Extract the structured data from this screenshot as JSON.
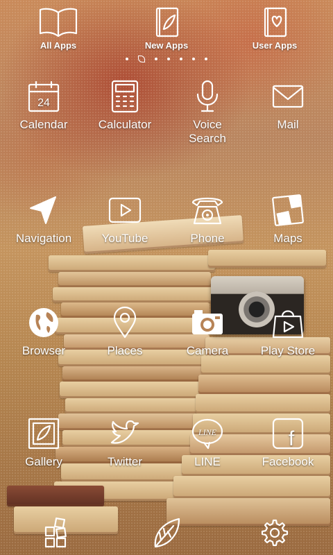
{
  "tabs": [
    {
      "label": "All Apps",
      "icon": "open-book-icon"
    },
    {
      "label": "New Apps",
      "icon": "leaf-book-icon"
    },
    {
      "label": "User Apps",
      "icon": "heart-book-icon"
    }
  ],
  "apps": [
    {
      "label": "Calendar",
      "icon": "calendar-icon",
      "day": "24"
    },
    {
      "label": "Calculator",
      "icon": "calculator-icon"
    },
    {
      "label": "Voice\nSearch",
      "icon": "microphone-icon"
    },
    {
      "label": "Mail",
      "icon": "envelope-icon"
    },
    {
      "label": "Navigation",
      "icon": "navigation-arrow-icon"
    },
    {
      "label": "YouTube",
      "icon": "play-button-icon"
    },
    {
      "label": "Phone",
      "icon": "rotary-phone-icon"
    },
    {
      "label": "Maps",
      "icon": "map-icon"
    },
    {
      "label": "Browser",
      "icon": "globe-icon"
    },
    {
      "label": "Places",
      "icon": "location-pin-icon"
    },
    {
      "label": "Camera",
      "icon": "camera-icon"
    },
    {
      "label": "Play Store",
      "icon": "shopping-bag-play-icon"
    },
    {
      "label": "Gallery",
      "icon": "picture-frame-icon"
    },
    {
      "label": "Twitter",
      "icon": "bird-icon"
    },
    {
      "label": "LINE",
      "icon": "line-bubble-icon",
      "bubble_text": "LINE"
    },
    {
      "label": "Facebook",
      "icon": "facebook-icon",
      "letter": "f"
    }
  ],
  "dock": [
    {
      "icon": "app-grid-icon"
    },
    {
      "icon": "leaf-icon"
    },
    {
      "icon": "settings-gear-icon"
    }
  ],
  "colors": {
    "icon_stroke": "#ffffff",
    "label": "#ffffff"
  }
}
